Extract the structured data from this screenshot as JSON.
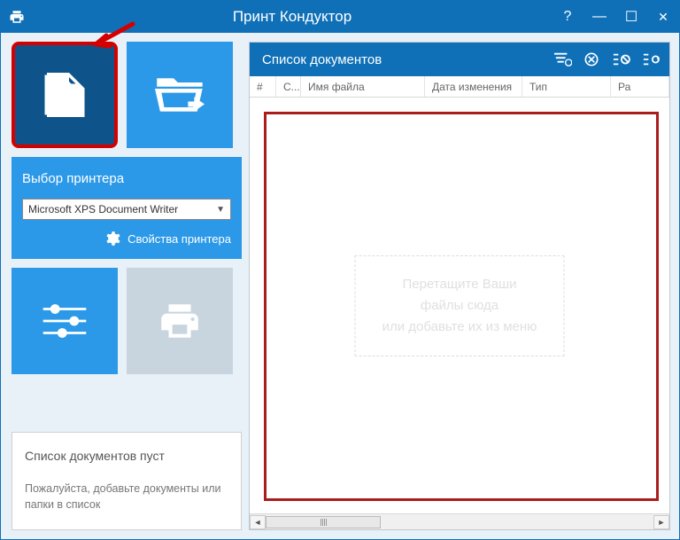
{
  "titlebar": {
    "title": "Принт Кондуктор"
  },
  "sidebar": {
    "printer_panel_title": "Выбор принтера",
    "selected_printer": "Microsoft XPS Document Writer",
    "printer_props_label": "Свойства принтера"
  },
  "status": {
    "title": "Список документов пуст",
    "text": "Пожалуйста, добавьте документы или папки в список"
  },
  "doclist": {
    "title": "Список документов",
    "columns": {
      "num": "#",
      "status": "С...",
      "name": "Имя файла",
      "date": "Дата изменения",
      "type": "Тип",
      "size": "Ра"
    },
    "hint_line1": "Перетащите Ваши файлы сюда",
    "hint_line2": "или добавьте их из меню"
  }
}
